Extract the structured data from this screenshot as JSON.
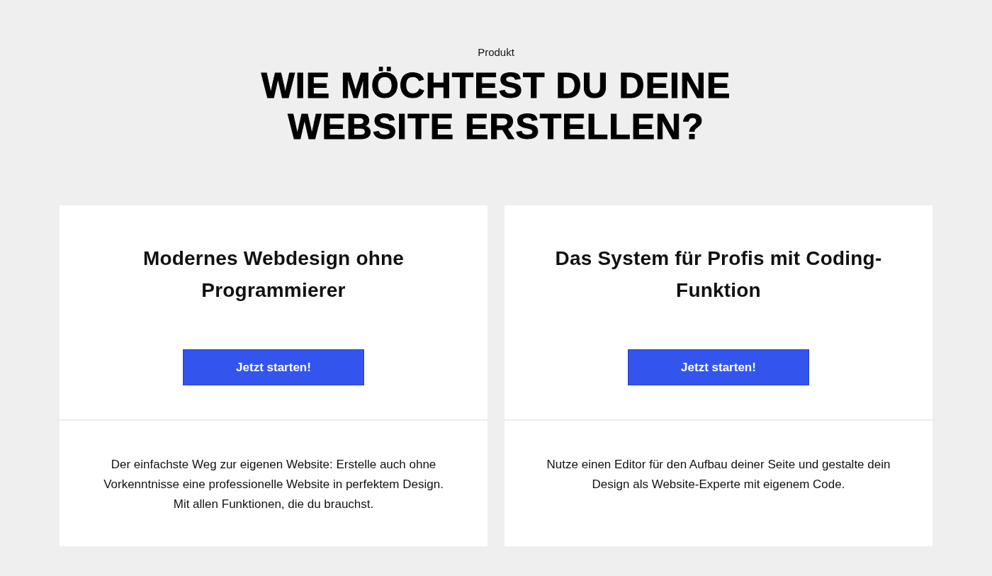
{
  "eyebrow": "Produkt",
  "heading": "WIE MÖCHTEST DU DEINE WEBSITE ERSTELLEN?",
  "cards": [
    {
      "title": "Modernes Webdesign ohne Programmierer",
      "button": "Jetzt starten!",
      "description": "Der einfachste Weg zur eigenen Website: Erstelle auch ohne Vorkenntnisse eine professionelle Website in perfektem Design. Mit allen Funktionen, die du brauchst."
    },
    {
      "title": "Das System für Profis mit Coding-Funktion",
      "button": "Jetzt starten!",
      "description": "Nutze einen Editor für den Aufbau deiner Seite und gestalte dein Design als Website-Experte mit eigenem Code."
    }
  ]
}
